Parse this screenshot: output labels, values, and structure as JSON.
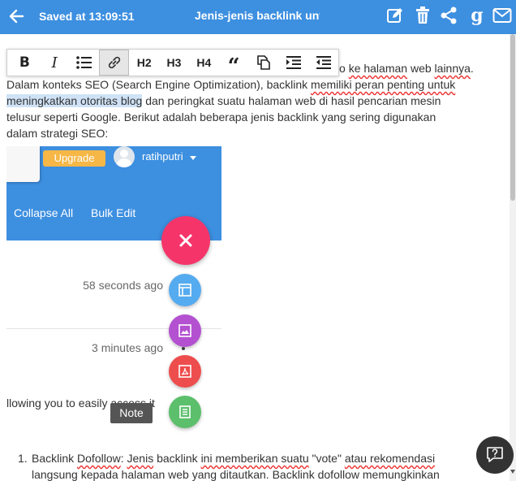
{
  "header": {
    "saved_status": "Saved at 13:09:51",
    "title": "Jenis-jenis backlink untu",
    "icons": [
      "back-arrow-icon",
      "edit-icon",
      "trash-icon",
      "share-icon",
      "google-icon",
      "mail-icon"
    ],
    "google_letter": "g"
  },
  "toolbar": {
    "items": [
      {
        "name": "bold",
        "label": "B"
      },
      {
        "name": "italic",
        "label": "I"
      },
      {
        "name": "bullet-list",
        "icon": "list-icon"
      },
      {
        "name": "link",
        "icon": "link-icon",
        "active": true
      },
      {
        "name": "h2",
        "label": "H2"
      },
      {
        "name": "h3",
        "label": "H3"
      },
      {
        "name": "h4",
        "label": "H4"
      },
      {
        "name": "quote",
        "label": "“"
      },
      {
        "name": "copy",
        "icon": "copy-icon"
      },
      {
        "name": "indent",
        "icon": "indent-icon"
      },
      {
        "name": "outdent",
        "icon": "outdent-icon"
      }
    ]
  },
  "body": {
    "line1_tail_a": "o ",
    "line1_link": "ke halaman",
    "line1_tail_b": " web ",
    "line1_word": "lainnya",
    "line1_end": ".",
    "line2_a": "Dalam konteks SEO (Search Engine Optimization), backlink ",
    "line2_b": "memiliki peran penting untuk",
    "line3_hl": "meningkatkan otoritas blog",
    "line3_rest": " dan peringkat suatu halaman web di hasil pencarian mesin",
    "line4": "telusur seperti Google. Berikut adalah beberapa jenis backlink yang sering digunakan",
    "line5": "dalam strategi SEO:"
  },
  "embedded": {
    "upgrade": "Upgrade",
    "username": "ratihputri",
    "collapse_all": "Collapse All",
    "bulk_edit": "Bulk Edit",
    "timestamp_1": "58 seconds ago",
    "timestamp_2": "3 minutes ago",
    "access_text": "llowing you to easily access it"
  },
  "fab": {
    "main_icon": "close-icon",
    "actions": [
      {
        "name": "layout",
        "icon": "layout-icon",
        "color": "#55abef"
      },
      {
        "name": "image",
        "icon": "image-icon",
        "color": "#b351d1"
      },
      {
        "name": "pdf",
        "icon": "pdf-icon",
        "color": "#ee4d4d"
      },
      {
        "name": "note",
        "icon": "note-icon",
        "color": "#5bbf6b"
      }
    ],
    "tooltip": "Note"
  },
  "list": {
    "number": "1.",
    "l1_a": "Backlink ",
    "l1_b": "Dofollow",
    "l1_c": ": ",
    "l1_d": "Jenis",
    "l1_e": " backlink ",
    "l1_f": "ini memberikan suatu",
    "l1_g": " \"vote\" ",
    "l1_h": "atau rekomendasi",
    "l2_a": "langsung kepada halaman",
    "l2_b": " web yang ",
    "l2_c": "ditautkan",
    "l2_d": ". Backlink ",
    "l2_e": "dofollow memungkinkan"
  },
  "colors": {
    "header_blue": "#3d8fe0",
    "fab_pink": "#f5356a",
    "upgrade_orange": "#f6b746",
    "highlight": "#cfe2f6",
    "spell_red": "#e33"
  }
}
